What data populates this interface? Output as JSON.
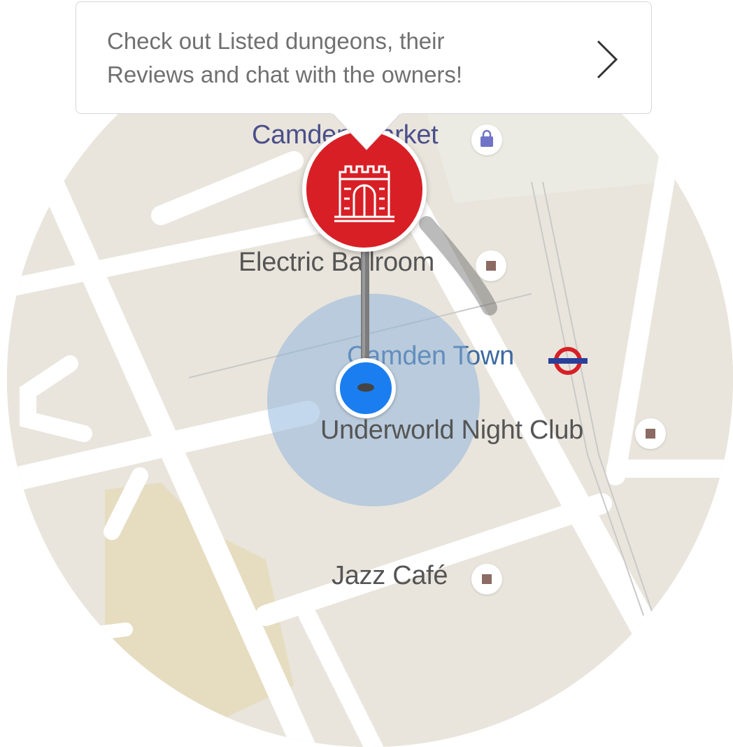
{
  "tooltip": {
    "line1": "Check out Listed dungeons, their",
    "line2": "Reviews and chat with the owners!",
    "chevron_icon": "chevron-right-icon"
  },
  "marker": {
    "icon": "castle-icon",
    "color": "#d81f26"
  },
  "user_location": {
    "icon": "current-location-dot",
    "color": "#1a7ef0"
  },
  "places": {
    "camden_market": "Camden Market",
    "electric_ballroom": "Electric Ballroom",
    "camden_town": "Camden Town",
    "underworld": "Underworld Night Club",
    "jazz_cafe": "Jazz Café"
  },
  "icons": {
    "shopping": "shopping-bag-icon",
    "venue": "venue-icon",
    "underground": "london-underground-icon"
  }
}
